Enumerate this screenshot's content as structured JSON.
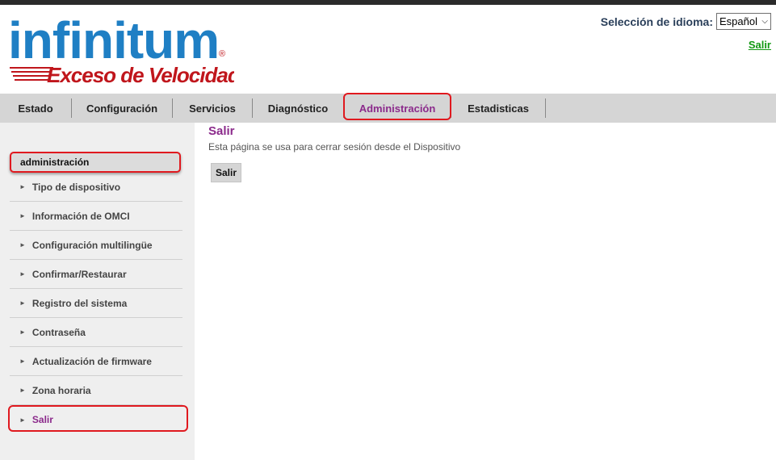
{
  "header": {
    "logo_main": "infinitum",
    "logo_reg": "®",
    "logo_tagline": "Exceso de Velocidad",
    "language_label": "Selección de idioma:",
    "language_selected": "Español",
    "logout_link": "Salir"
  },
  "nav": {
    "items": [
      {
        "label": "Estado"
      },
      {
        "label": "Configuración"
      },
      {
        "label": "Servicios"
      },
      {
        "label": "Diagnóstico"
      },
      {
        "label": "Administración"
      },
      {
        "label": "Estadisticas"
      }
    ],
    "active": "Administración"
  },
  "sidebar": {
    "header": "administración",
    "items": [
      {
        "label": "Tipo de dispositivo"
      },
      {
        "label": "Información de OMCI"
      },
      {
        "label": "Configuración multilingüe"
      },
      {
        "label": "Confirmar/Restaurar"
      },
      {
        "label": "Registro del sistema"
      },
      {
        "label": "Contraseña"
      },
      {
        "label": "Actualización de firmware"
      },
      {
        "label": "Zona horaria"
      },
      {
        "label": "Salir"
      }
    ],
    "active": "Salir"
  },
  "main": {
    "title": "Salir",
    "description": "Esta página se usa para cerrar sesión desde el Dispositivo",
    "button_label": "Salir"
  },
  "colors": {
    "brand_blue": "#1f7fc4",
    "brand_red": "#c0161c",
    "accent_purple": "#8b2a8b",
    "highlight_red": "#e0191f",
    "link_green": "#139913"
  }
}
